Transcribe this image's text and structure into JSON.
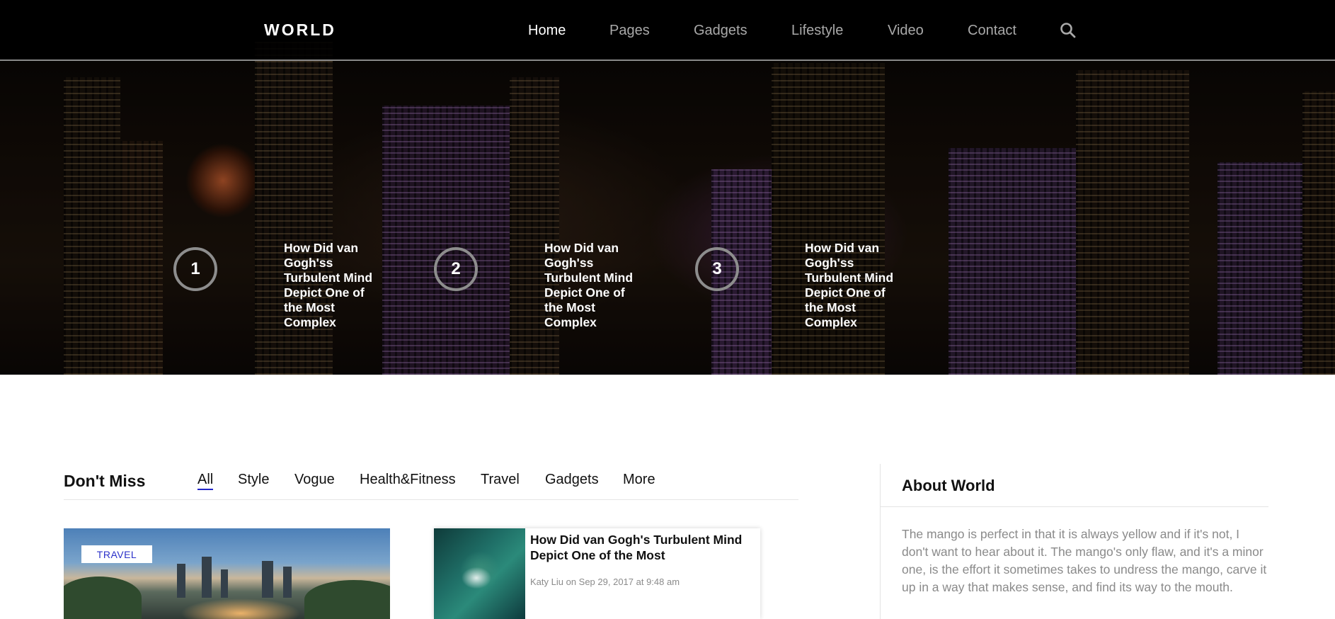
{
  "nav": {
    "logo": "WORLD",
    "items": [
      {
        "label": "Home",
        "active": true
      },
      {
        "label": "Pages",
        "active": false
      },
      {
        "label": "Gadgets",
        "active": false
      },
      {
        "label": "Lifestyle",
        "active": false
      },
      {
        "label": "Video",
        "active": false
      },
      {
        "label": "Contact",
        "active": false
      }
    ],
    "search_icon": "search-icon"
  },
  "slides": [
    {
      "number": "1",
      "title": "How Did van Gogh'ss Turbulent Mind Depict One of the Most Complex"
    },
    {
      "number": "2",
      "title": "How Did van Gogh'ss Turbulent Mind Depict One of the Most Complex"
    },
    {
      "number": "3",
      "title": "How Did van Gogh'ss Turbulent Mind Depict One of the Most Complex"
    }
  ],
  "dont_miss": {
    "title": "Don't Miss",
    "tabs": [
      "All",
      "Style",
      "Vogue",
      "Health&Fitness",
      "Travel",
      "Gadgets",
      "More"
    ],
    "active_tab": "All",
    "feature": {
      "badge": "TRAVEL"
    },
    "card": {
      "title": "How Did van Gogh's Turbulent Mind Depict One of the Most",
      "meta": "Katy Liu on Sep 29, 2017 at 9:48 am"
    }
  },
  "sidebar": {
    "about_title": "About World",
    "about_text": "The mango is perfect in that it is always yellow and if it's not, I don't want to hear about it. The mango's only flaw, and it's a minor one, is the effort it sometimes takes to undress the mango, carve it up in a way that makes sense, and find its way to the mouth."
  },
  "colors": {
    "accent": "#2b31c9",
    "nav_bg": "#000000",
    "nav_text_inactive": "#a9a9a9",
    "body_text_muted": "#8a8a8a"
  }
}
